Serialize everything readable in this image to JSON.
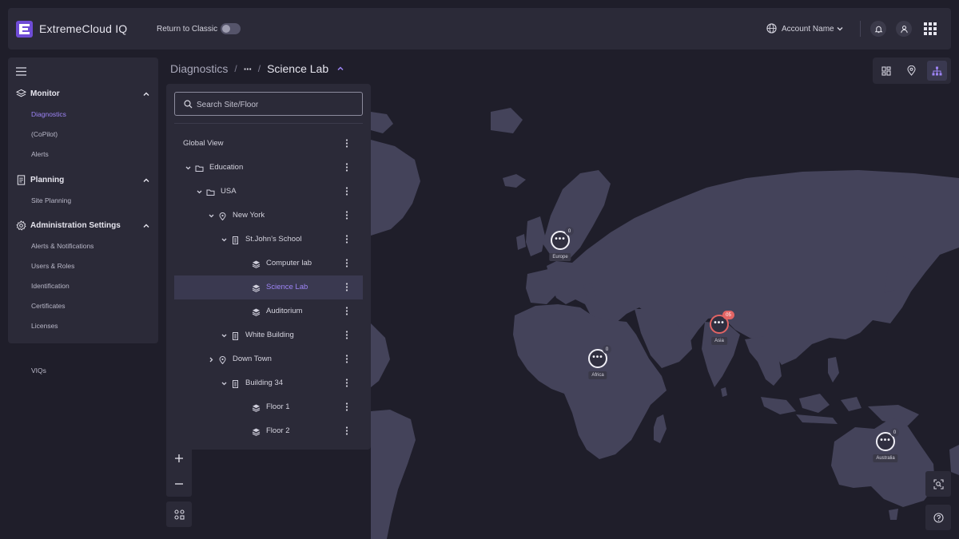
{
  "app": {
    "name": "ExtremeCloud IQ"
  },
  "header": {
    "return_label": "Return to Classic",
    "account_name": "Account Name"
  },
  "sidebar": {
    "sections": [
      {
        "label": "Monitor",
        "icon": "layers-icon",
        "items": [
          "Diagnostics",
          "(CoPilot)",
          "Alerts"
        ],
        "active": "Diagnostics"
      },
      {
        "label": "Planning",
        "icon": "document-icon",
        "items": [
          "Site Planning"
        ]
      },
      {
        "label": "Administration Settings",
        "icon": "gear-icon",
        "items": [
          "Alerts & Notifications",
          "Users & Roles",
          "Identification",
          "Certificates",
          "Licenses"
        ]
      }
    ],
    "extra_item": "VIQs"
  },
  "breadcrumb": {
    "root": "Diagnostics",
    "separator": "/",
    "ellipsis": "···",
    "current": "Science Lab"
  },
  "search": {
    "placeholder": "Search Site/Floor",
    "value": ""
  },
  "tree": [
    {
      "label": "Global View",
      "type": "global",
      "level": 0
    },
    {
      "label": "Education",
      "type": "folder",
      "level": 1,
      "expanded": true
    },
    {
      "label": "USA",
      "type": "folder",
      "level": 2,
      "expanded": true
    },
    {
      "label": "New York",
      "type": "location",
      "level": 3,
      "expanded": true
    },
    {
      "label": "St.John's School",
      "type": "building",
      "level": 4,
      "expanded": true
    },
    {
      "label": "Computer lab",
      "type": "floor",
      "level": 5
    },
    {
      "label": "Science Lab",
      "type": "floor",
      "level": 5,
      "selected": true
    },
    {
      "label": "Auditorium",
      "type": "floor",
      "level": 5
    },
    {
      "label": "White Building",
      "type": "building",
      "level": 4,
      "expanded": true
    },
    {
      "label": "Down Town",
      "type": "location",
      "level": 3,
      "expanded": false
    },
    {
      "label": "Building 34",
      "type": "building",
      "level": 4,
      "expanded": true
    },
    {
      "label": "Floor 1",
      "type": "floor",
      "level": 5
    },
    {
      "label": "Floor 2",
      "type": "floor",
      "level": 5
    }
  ],
  "map": {
    "clusters": [
      {
        "label": "Europe",
        "count": "0",
        "alert": false
      },
      {
        "label": "Asia",
        "count": "05",
        "alert": true
      },
      {
        "label": "Africa",
        "count": "0",
        "alert": false
      },
      {
        "label": "Australia",
        "count": "0",
        "alert": false
      }
    ],
    "cluster_glyph": "•••"
  },
  "colors": {
    "accent": "#9d84f5",
    "brand": "#6f4cd6",
    "alert": "#e26464",
    "land": "#44435a",
    "background": "#1f1e2a",
    "panel": "#2b2a38"
  }
}
